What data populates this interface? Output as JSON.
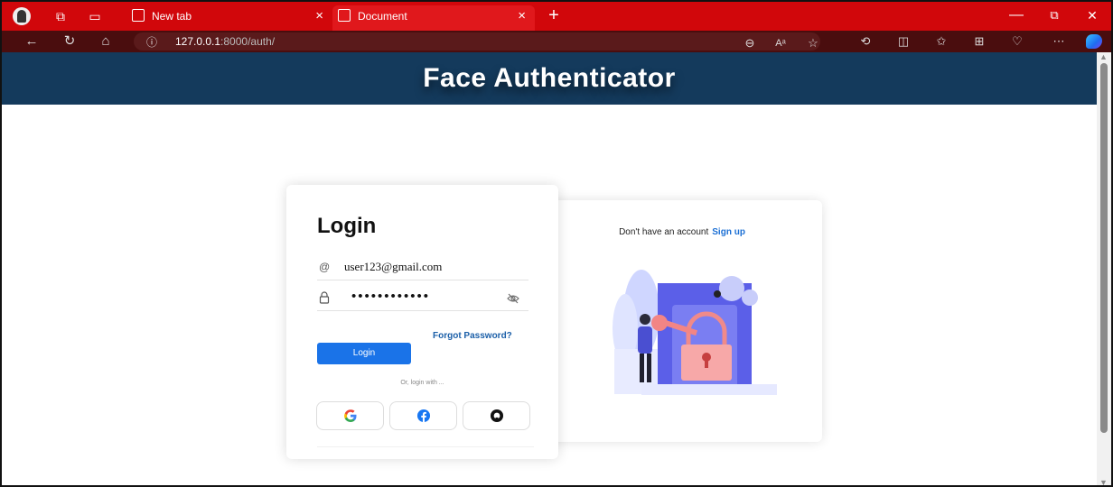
{
  "browser": {
    "tabs": [
      {
        "label": "New tab"
      },
      {
        "label": "Document"
      }
    ],
    "tab_close_glyph": "×",
    "new_tab_glyph": "+",
    "url_host": "127.0.0.1",
    "url_path": ":8000/auth/",
    "window_controls": {
      "minimize": "—",
      "restore": "⧉",
      "close": "✕"
    },
    "accent_color": "#d1070b"
  },
  "page": {
    "header_title": "Face Authenticator",
    "header_color": "#143a5c"
  },
  "login": {
    "title": "Login",
    "email_value": "user123@gmail.com",
    "password_mask": "••••••••••••",
    "forgot_password": "Forgot Password?",
    "login_button": "Login",
    "or_text": "Or, login with ...",
    "button_color": "#1a73e8",
    "social_icons": [
      "google-icon",
      "facebook-icon",
      "github-icon"
    ]
  },
  "signup": {
    "prompt": "Don't have an account",
    "link": "Sign up"
  }
}
